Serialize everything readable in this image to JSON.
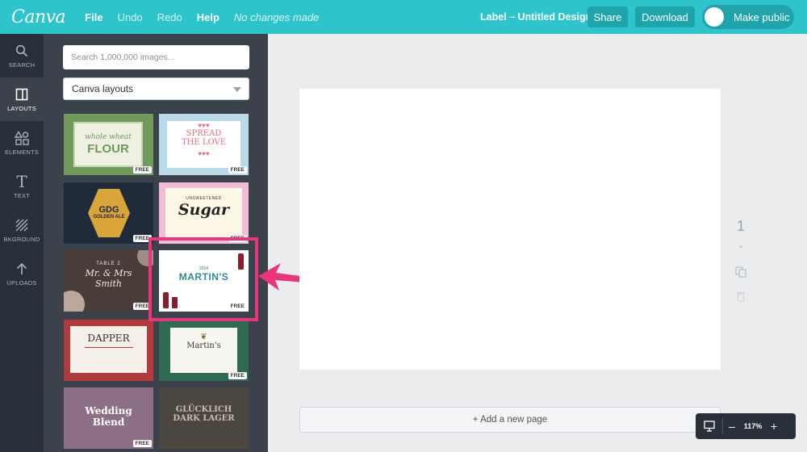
{
  "app": {
    "logo": "Canva"
  },
  "menu": {
    "file": "File",
    "undo": "Undo",
    "redo": "Redo",
    "help": "Help",
    "status": "No changes made"
  },
  "header": {
    "design_title": "Label – Untitled Design",
    "share": "Share",
    "download": "Download",
    "make_public": "Make public"
  },
  "rail": {
    "items": [
      {
        "label": "SEARCH",
        "icon": "search-icon"
      },
      {
        "label": "LAYOUTS",
        "icon": "layouts-icon"
      },
      {
        "label": "ELEMENTS",
        "icon": "elements-icon"
      },
      {
        "label": "TEXT",
        "icon": "text-icon"
      },
      {
        "label": "BKGROUND",
        "icon": "background-icon"
      },
      {
        "label": "UPLOADS",
        "icon": "upload-icon"
      }
    ]
  },
  "panel": {
    "search_placeholder": "Search 1,000,000 images...",
    "layout_select": "Canva layouts",
    "free_label": "FREE",
    "thumbs": [
      {
        "text1": "whole wheat",
        "text2": "FLOUR"
      },
      {
        "text1": "SPREAD",
        "text2": "THE LOVE"
      },
      {
        "text1": "GDG",
        "text2": "GOLDEN ALE"
      },
      {
        "text1": "UNSWEETENED",
        "text2": "Sugar"
      },
      {
        "text1": "TABLE 2",
        "text2": "Mr. & Mrs",
        "text3": "Smith"
      },
      {
        "text1": "2014",
        "text2": "MARTIN'S"
      },
      {
        "text1": "DAPPER",
        "text2": ""
      },
      {
        "text1": "Martin's",
        "text2": ""
      },
      {
        "text1": "Wedding",
        "text2": "Blend"
      },
      {
        "text1": "GLÜCKLICH",
        "text2": "DARK LAGER"
      }
    ]
  },
  "canvas": {
    "add_page": "+ Add a new page",
    "page_number": "1"
  },
  "zoom": {
    "value": "117%",
    "minus": "–",
    "plus": "+"
  },
  "colors": {
    "accent": "#2ec4cc",
    "callout": "#e9357a",
    "rail": "#293039",
    "panel": "#3b424c"
  }
}
